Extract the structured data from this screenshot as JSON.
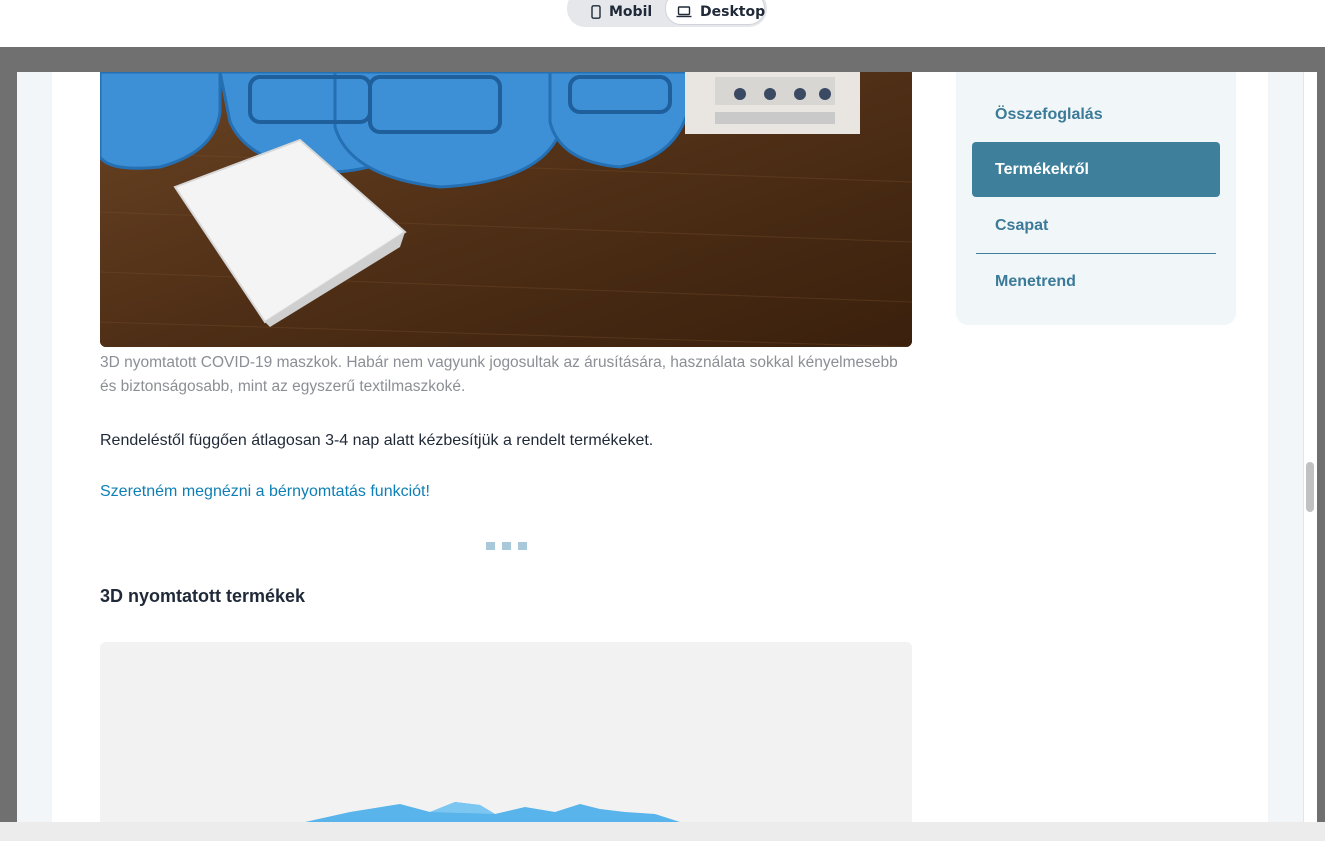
{
  "view_toggle": {
    "mobile_label": "Mobil",
    "desktop_label": "Desktop",
    "selected": "Desktop"
  },
  "article": {
    "hero_image_alt": "3D nyomtatott COVID-19 maszkok",
    "caption": "3D nyomtatott COVID-19 maszkok. Habár nem vagyunk jogosultak az árusítására, használata sokkal kényelmesebb és biztonságosabb, mint az egyszerű textilmaszkoké.",
    "body": "Rendeléstől függően átlagosan 3-4 nap alatt kézbesítjük a rendelt termékeket.",
    "link_text": "Szeretném megnézni a bérnyomtatás funkciót!",
    "section_heading": "3D nyomtatott termékek"
  },
  "sidebar": {
    "items": [
      {
        "label": "Összefoglalás",
        "active": false
      },
      {
        "label": "Termékekről",
        "active": true
      },
      {
        "label": "Csapat",
        "active": false
      },
      {
        "label": "Menetrend",
        "active": false
      }
    ]
  },
  "colors": {
    "accent": "#3e7f9c",
    "link": "#0e7fb5",
    "sidebar_bg": "#f1f6f8"
  }
}
